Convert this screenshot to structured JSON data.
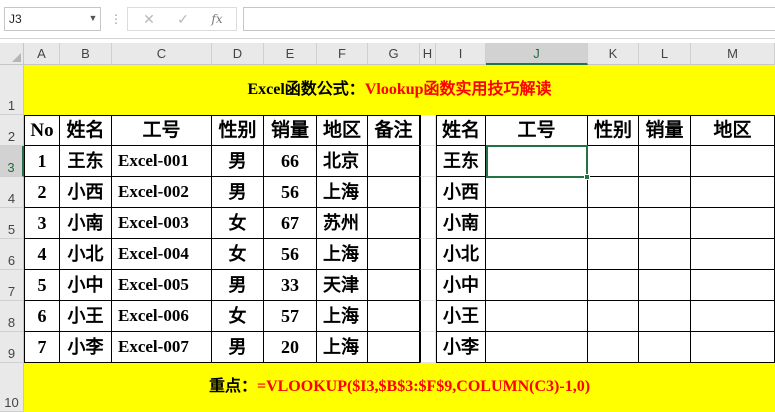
{
  "formula_bar": {
    "name_box": "J3",
    "cancel_icon": "✕",
    "enter_icon": "✓",
    "fx_label": "fx",
    "formula": ""
  },
  "columns": [
    "A",
    "B",
    "C",
    "D",
    "E",
    "F",
    "G",
    "H",
    "I",
    "J",
    "K",
    "L",
    "M"
  ],
  "rows": [
    "1",
    "2",
    "3",
    "4",
    "5",
    "6",
    "7",
    "8",
    "9",
    "10"
  ],
  "title": {
    "part1": "Excel函数公式：",
    "part2": "Vlookup函数实用技巧解读"
  },
  "source_table": {
    "headers": [
      "No",
      "姓名",
      "工号",
      "性别",
      "销量",
      "地区",
      "备注"
    ],
    "rows": [
      [
        "1",
        "王东",
        "Excel-001",
        "男",
        "66",
        "北京",
        ""
      ],
      [
        "2",
        "小西",
        "Excel-002",
        "男",
        "56",
        "上海",
        ""
      ],
      [
        "3",
        "小南",
        "Excel-003",
        "女",
        "67",
        "苏州",
        ""
      ],
      [
        "4",
        "小北",
        "Excel-004",
        "女",
        "56",
        "上海",
        ""
      ],
      [
        "5",
        "小中",
        "Excel-005",
        "男",
        "33",
        "天津",
        ""
      ],
      [
        "6",
        "小王",
        "Excel-006",
        "女",
        "57",
        "上海",
        ""
      ],
      [
        "7",
        "小李",
        "Excel-007",
        "男",
        "20",
        "上海",
        ""
      ]
    ]
  },
  "lookup_table": {
    "headers": [
      "姓名",
      "工号",
      "性别",
      "销量",
      "地区"
    ],
    "names": [
      "王东",
      "小西",
      "小南",
      "小北",
      "小中",
      "小王",
      "小李"
    ]
  },
  "note": {
    "label": "重点：",
    "formula": "=VLOOKUP($I3,$B$3:$F$9,COLUMN(C3)-1,0)"
  },
  "colors": {
    "band": "#ffff00",
    "accent_red": "#ff0000",
    "selection": "#217346"
  }
}
